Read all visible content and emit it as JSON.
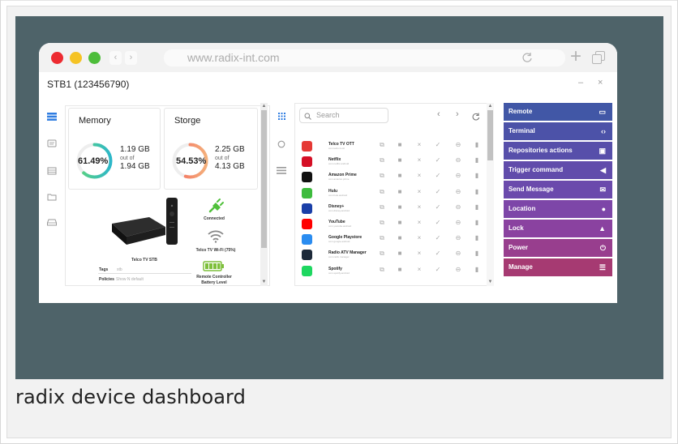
{
  "browser": {
    "url": "www.radix-int.com",
    "nav_back": "‹",
    "nav_forward": "›"
  },
  "device": {
    "title": "STB1 (123456790)",
    "minimize": "–",
    "close": "×"
  },
  "memory": {
    "title": "Memory",
    "percent": "61.49%",
    "percent_value": 61.49,
    "used": "1.19 GB",
    "out_of": "out of",
    "total": "1.94 GB"
  },
  "storage": {
    "title": "Storge",
    "percent": "54.53%",
    "percent_value": 54.53,
    "used": "2.25 GB",
    "out_of": "out of",
    "total": "4.13 GB"
  },
  "info": {
    "device_name": "Telco TV STB",
    "tags_label": "Tags",
    "tags_value": "stb",
    "policies_label": "Policies",
    "policies_value": "Show N default",
    "power_status": "Connected",
    "wifi_status": "Telco TV Wi-Fi (75%)",
    "remote_battery": "Remote Controller Battery Level"
  },
  "apps": {
    "search_placeholder": "Search",
    "items": [
      {
        "name": "Telco TV OTT",
        "package": "com.telco.tv.ott",
        "color": "#e53935"
      },
      {
        "name": "Netflix",
        "package": "com.netflix.android",
        "color": "#d50f25"
      },
      {
        "name": "Amazon Prime",
        "package": "com.amazon.prime",
        "color": "#111111"
      },
      {
        "name": "Hulu",
        "package": "com.hulu.android",
        "color": "#3dbb3d"
      },
      {
        "name": "Disney+",
        "package": "com.disney.android",
        "color": "#1a3fa8"
      },
      {
        "name": "YouTube",
        "package": "com.youtube.android",
        "color": "#ff0000"
      },
      {
        "name": "Google Playstore",
        "package": "com.google.android",
        "color": "#2a8cf0"
      },
      {
        "name": "Radio ATV Manager",
        "package": "com.radix.manager",
        "color": "#1d2a3a"
      },
      {
        "name": "Spotify",
        "package": "com.spotify.android",
        "color": "#1ed760"
      }
    ]
  },
  "menu": [
    {
      "label": "Remote",
      "icon": "monitor-icon",
      "glyph": "▭",
      "color": "#4157a6"
    },
    {
      "label": "Terminal",
      "icon": "code-icon",
      "glyph": "‹›",
      "color": "#4c52a8"
    },
    {
      "label": "Repositories actions",
      "icon": "clipboard-icon",
      "glyph": "▣",
      "color": "#574faa"
    },
    {
      "label": "Trigger command",
      "icon": "megaphone-icon",
      "glyph": "◀",
      "color": "#614cab"
    },
    {
      "label": "Send Message",
      "icon": "envelope-icon",
      "glyph": "✉",
      "color": "#6b4aac"
    },
    {
      "label": "Location",
      "icon": "map-pin-icon",
      "glyph": "●",
      "color": "#7d46a8"
    },
    {
      "label": "Lock",
      "icon": "lock-icon",
      "glyph": "▲",
      "color": "#8a42a0"
    },
    {
      "label": "Power",
      "icon": "power-icon",
      "glyph": "⏻",
      "color": "#983e8e"
    },
    {
      "label": "Manage",
      "icon": "list-icon",
      "glyph": "☰",
      "color": "#a63a72"
    }
  ],
  "caption": "radix device dashboard"
}
